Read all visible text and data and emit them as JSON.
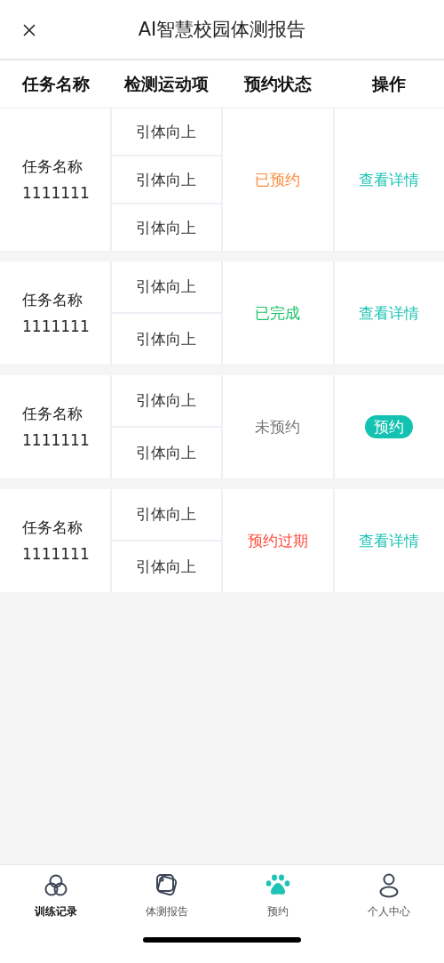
{
  "header": {
    "title": "AI智慧校园体测报告"
  },
  "table": {
    "columns": [
      "任务名称",
      "检测运动项",
      "预约状态",
      "操作"
    ],
    "groups": [
      {
        "name": "任务名称\n1111111",
        "items": [
          "引体向上",
          "引体向上",
          "引体向上"
        ],
        "status": {
          "kind": "booked",
          "text": "已预约"
        },
        "action": {
          "kind": "link",
          "text": "查看详情"
        }
      },
      {
        "name": "任务名称\n1111111",
        "items": [
          "引体向上",
          "引体向上"
        ],
        "status": {
          "kind": "done",
          "text": "已完成"
        },
        "action": {
          "kind": "link",
          "text": "查看详情"
        }
      },
      {
        "name": "任务名称\n1111111",
        "items": [
          "引体向上",
          "引体向上"
        ],
        "status": {
          "kind": "pending",
          "text": "未预约"
        },
        "action": {
          "kind": "button",
          "text": "预约"
        }
      },
      {
        "name": "任务名称\n1111111",
        "items": [
          "引体向上",
          "引体向上"
        ],
        "status": {
          "kind": "expired",
          "text": "预约过期"
        },
        "action": {
          "kind": "link",
          "text": "查看详情"
        }
      }
    ]
  },
  "tab_bar": [
    {
      "kind": "records",
      "label": "训练记录",
      "selected": true
    },
    {
      "kind": "report",
      "label": "体测报告",
      "selected": false
    },
    {
      "kind": "booking",
      "label": "预约",
      "selected": false
    },
    {
      "kind": "profile",
      "label": "个人中心",
      "selected": false
    }
  ]
}
